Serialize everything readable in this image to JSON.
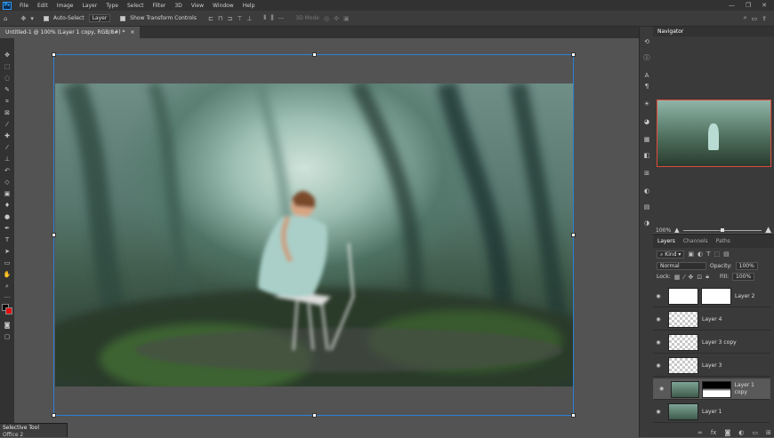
{
  "menu": {
    "items": [
      "File",
      "Edit",
      "Image",
      "Layer",
      "Type",
      "Select",
      "Filter",
      "3D",
      "View",
      "Window",
      "Help"
    ],
    "window_controls": [
      "—",
      "❐",
      "✕"
    ]
  },
  "options": {
    "auto_select_label": "Auto-Select",
    "auto_select_target": "Layer",
    "show_transform_label": "Show Transform Controls",
    "mode_3d": "3D Mode"
  },
  "document": {
    "tab_title": "Untitled-1 @ 100% (Layer 1 copy, RGB/8#) *",
    "tab_close": "×"
  },
  "navigator": {
    "title": "Navigator",
    "zoom": "100%"
  },
  "layers": {
    "tabs": [
      "Layers",
      "Channels",
      "Paths"
    ],
    "kind": "Kind",
    "blend": "Normal",
    "opacity_label": "Opacity:",
    "opacity_value": "100%",
    "lock_label": "Lock:",
    "fill_label": "Fill:",
    "fill_value": "100%",
    "items": [
      {
        "name": "Layer 2",
        "thumb": "figure",
        "mask": "white",
        "selected": false
      },
      {
        "name": "Layer 4",
        "thumb": "transparent",
        "mask": "",
        "selected": false
      },
      {
        "name": "Layer 3 copy",
        "thumb": "transparent",
        "mask": "",
        "selected": false
      },
      {
        "name": "Layer 3",
        "thumb": "transparent",
        "mask": "",
        "selected": false
      },
      {
        "name": "Layer 1 copy",
        "thumb": "image",
        "mask": "black-white",
        "selected": true
      },
      {
        "name": "Layer 1",
        "thumb": "image",
        "mask": "",
        "selected": false
      }
    ]
  },
  "bottom_panel": {
    "title": "Selective Tool",
    "item": "Office 2"
  },
  "colors": {
    "selection": "#2c7fd6",
    "panel": "#3a3a3a",
    "workspace": "#535353",
    "navigator_box": "#e04a3c"
  }
}
